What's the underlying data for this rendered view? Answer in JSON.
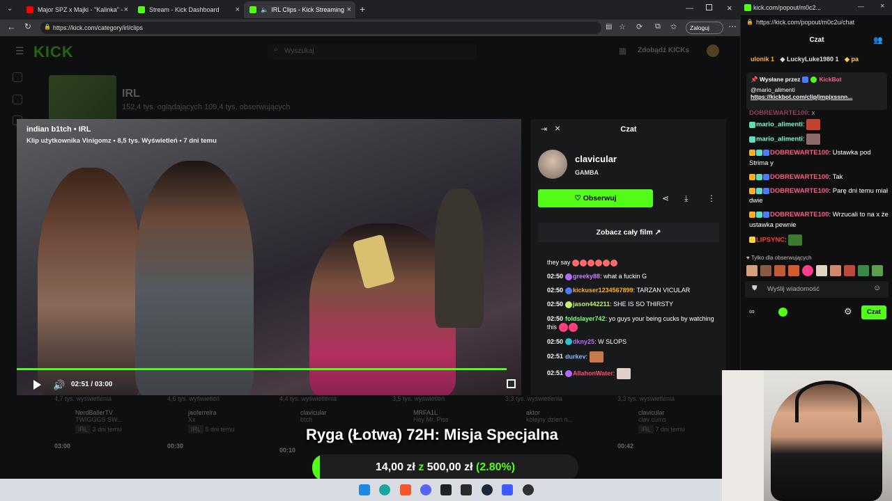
{
  "browser": {
    "tabs": [
      {
        "label": "Major SPZ x Majki - \"Kalinka\" - Yo",
        "color": "#ff0000"
      },
      {
        "label": "Stream - Kick Dashboard",
        "color": "#53fc18"
      },
      {
        "label": "IRL Clips - Kick Streaming",
        "color": "#53fc18"
      }
    ],
    "url": "https://kick.com/category/irl/clips",
    "profile_label": "Zaloguj"
  },
  "kick": {
    "search_placeholder": "Wyszukaj",
    "cta": "Zdobądź KICKs",
    "category": {
      "title": "IRL",
      "subtitle": "152,4 tys. oglądających  109,4 tys. obserwujących"
    }
  },
  "player": {
    "title": "indian b1tch • IRL",
    "subtitle": "Klip użytkownika Vinigomz • 8,5 tys. Wyświetleń • 7 dni temu",
    "time": "02:51 / 03:00",
    "progress": 0.95
  },
  "clip_chat": {
    "title": "Czat",
    "channel": "clavicular",
    "game": "GAMBA",
    "follow_label": "Obserwuj",
    "full_film_label": "Zobacz cały film",
    "first_line": "they say",
    "messages": [
      {
        "time": "02:50",
        "user": "greeky88",
        "color": "#c77dff",
        "text": "what a fuckin G"
      },
      {
        "time": "02:50",
        "user": "kickuser1234567899",
        "color": "#ffb020",
        "text": "TARZAN VICULAR"
      },
      {
        "time": "02:50",
        "user": "jason442211",
        "color": "#c5f06b",
        "text": "SHE IS SO THIRSTY"
      },
      {
        "time": "02:50",
        "user": "foldslayer742",
        "color": "#7dff7d",
        "text": "yo guys your being cucks by watching this"
      },
      {
        "time": "02:50",
        "user": "dkny25",
        "color": "#b36bff",
        "text": "W SLOPS"
      },
      {
        "time": "02:51",
        "user": "durkev",
        "color": "#8fb8ff",
        "text": ""
      },
      {
        "time": "02:51",
        "user": "AllahonWater",
        "color": "#ff4d6d",
        "text": ""
      }
    ]
  },
  "cards": [
    {
      "views": "4,7 tys. wyświetlenia",
      "channel": "NerdBallerTV",
      "title": "TWIGGGS SW...",
      "tag": "IRL",
      "age": "3 dni temu",
      "duration": "03:00"
    },
    {
      "views": "4,6 tys. wyświetleń",
      "channel": "jaoferreira",
      "title": "Xx",
      "tag": "IRL",
      "age": "5 dni temu",
      "duration": "00:30"
    },
    {
      "views": "4,4 tys. wyświetlenia",
      "channel": "clavicular",
      "title": "btch",
      "tag": "",
      "age": "",
      "duration": "00:10"
    },
    {
      "views": "3,5 tys. wyświetleń",
      "channel": "MRFA1L",
      "title": "Hey Mr. Piss",
      "tag": "",
      "age": "",
      "duration": ""
    },
    {
      "views": "3,3 tys. wyświetlenia",
      "channel": "aktor",
      "title": "kolejny dzień n...",
      "tag": "",
      "age": "",
      "duration": ""
    },
    {
      "views": "3,3 tys. wyświetlenia",
      "channel": "clavicular",
      "title": "clav cums",
      "tag": "IRL",
      "age": "7 dni temu",
      "duration": "00:42"
    }
  ],
  "banner": {
    "title": "Ryga (Łotwa) 72H: Misja Specjalna",
    "amount": "14,00 zł",
    "sep": "z",
    "goal": "500,00 zł",
    "percent": "(2.80%)",
    "fill_fraction": 0.028
  },
  "popout": {
    "tab_url": "kick.com/popout/m0c2...",
    "url": "https://kick.com/popout/m0c2u/chat",
    "title": "Czat",
    "gifters": [
      "ulonik 1",
      "LuckyLuke1980 1",
      "pa"
    ],
    "pinned_by": "Wysłane przez",
    "pinned_bot": "KickBot",
    "pinned_user": "@mario_alimenti",
    "pinned_link": "https://kickbot.com/clip/jmpjxssnn...",
    "messages": [
      {
        "user": "DOBREWARTE100",
        "color": "#ff5c8a",
        "text": "x"
      },
      {
        "user": "mario_alimenti",
        "color": "#7dffd1",
        "text": ""
      },
      {
        "user": "mario_alimenti",
        "color": "#7dffd1",
        "text": ""
      },
      {
        "user": "DOBREWARTE100",
        "color": "#ff5c8a",
        "text": "Ustawka pod Strima y"
      },
      {
        "user": "DOBREWARTE100",
        "color": "#ff5c8a",
        "text": "Tak"
      },
      {
        "user": "DOBREWARTE100",
        "color": "#ff5c8a",
        "text": "Parę dni temu miał dwie"
      },
      {
        "user": "DOBREWARTE100",
        "color": "#ff5c8a",
        "text": "Wrzucali to na x że ustawka pewnie"
      },
      {
        "user": "LIPSYNC",
        "color": "#ff3d3d",
        "text": ""
      }
    ],
    "subs_only": "Tylko dla obserwujących",
    "input_placeholder": "Wyślij wiadomość",
    "send_label": "Czat"
  }
}
